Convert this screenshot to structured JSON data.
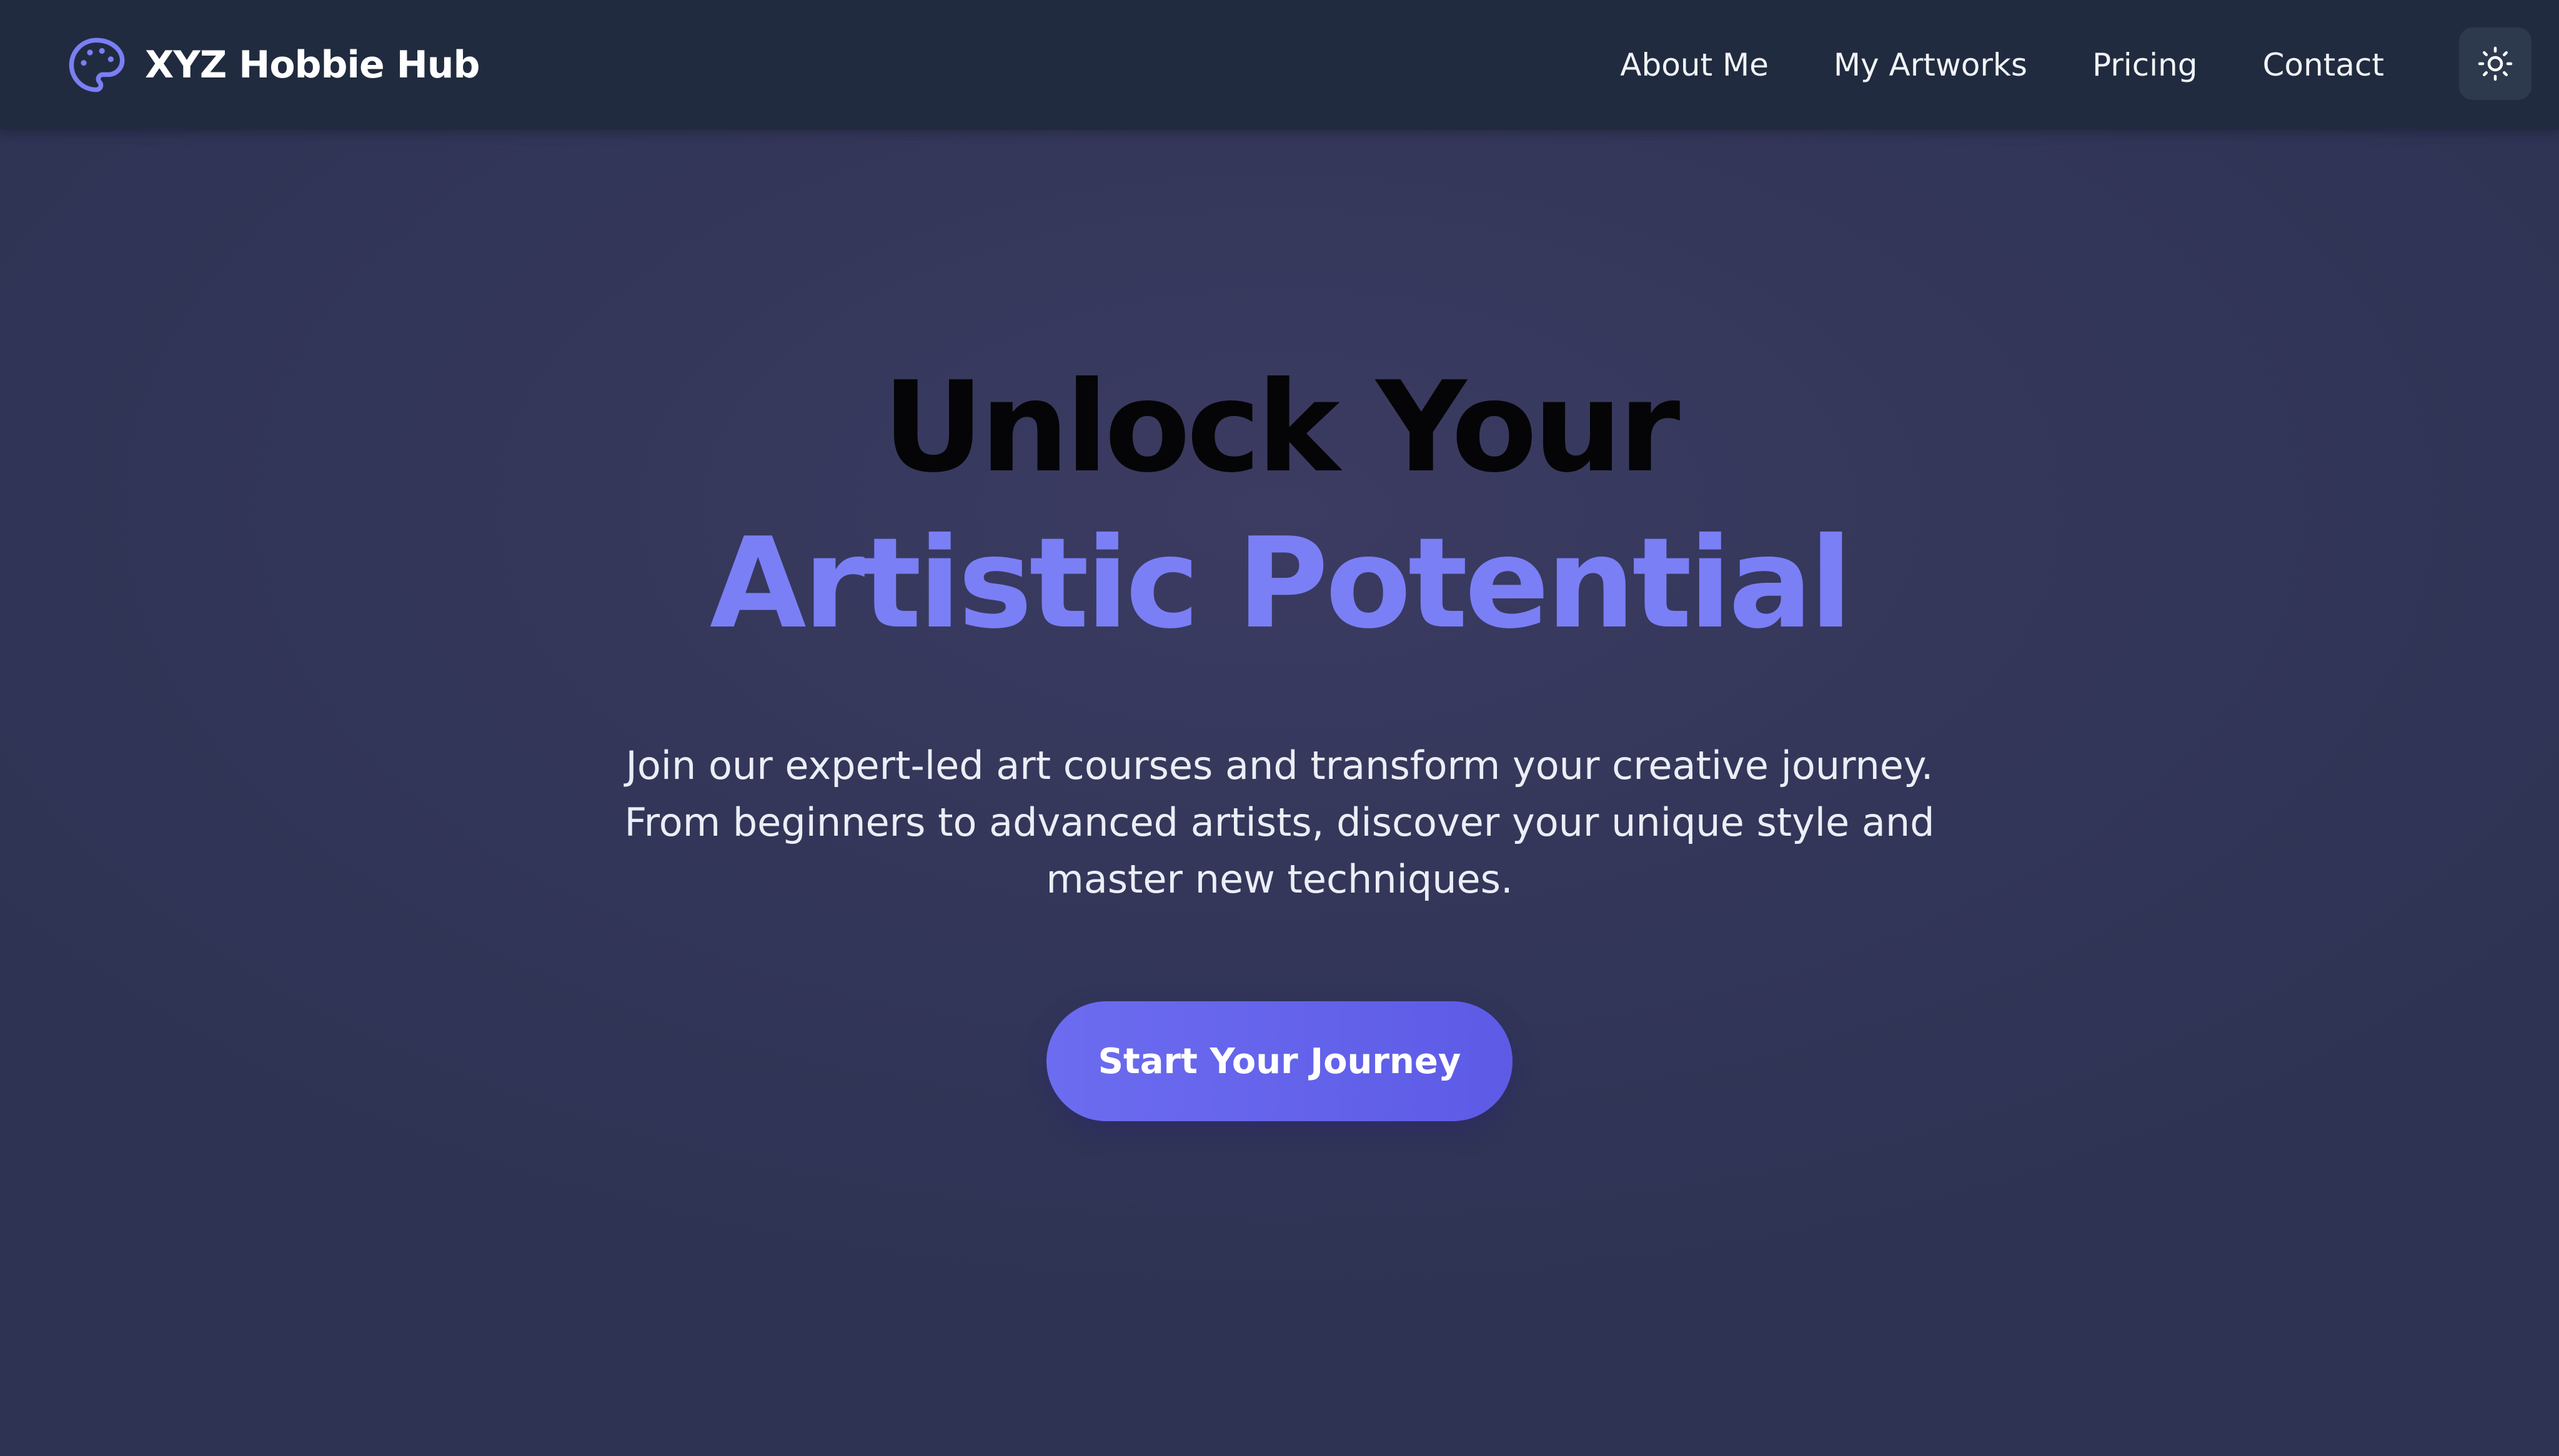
{
  "brand": {
    "name": "XYZ Hobbie Hub",
    "icon": "palette-icon",
    "icon_color": "#7a7ff5"
  },
  "nav": {
    "items": [
      {
        "label": "About Me"
      },
      {
        "label": "My Artworks"
      },
      {
        "label": "Pricing"
      },
      {
        "label": "Contact"
      }
    ],
    "theme_toggle_icon": "sun-icon"
  },
  "hero": {
    "title_line1": "Unlock Your",
    "title_line2": "Artistic Potential",
    "subtitle": "Join our expert-led art courses and transform your creative journey. From beginners to advanced artists, discover your unique style and master new techniques.",
    "cta_label": "Start Your Journey"
  },
  "colors": {
    "navbar_bg": "#212b3f",
    "page_bg": "#34375a",
    "accent": "#7a7ff5",
    "button": "#6466ee"
  }
}
